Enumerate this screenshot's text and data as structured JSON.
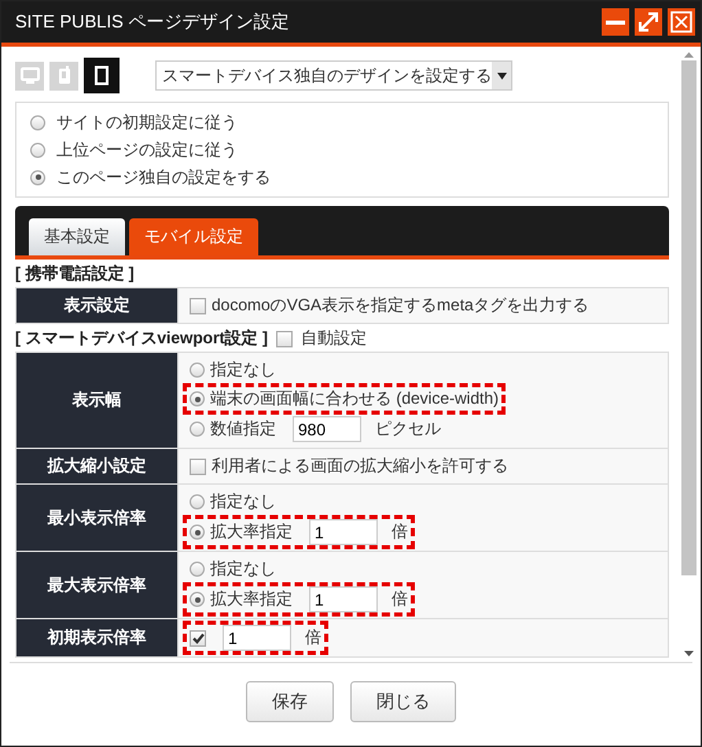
{
  "window": {
    "title": "SITE PUBLIS ページデザイン設定"
  },
  "window_controls": [
    {
      "kind": "minimize"
    },
    {
      "kind": "maximize"
    },
    {
      "kind": "close"
    }
  ],
  "devices": [
    {
      "kind": "desktop",
      "selected": false
    },
    {
      "kind": "mobile",
      "selected": false
    },
    {
      "kind": "smartphone",
      "selected": true
    }
  ],
  "design_select": {
    "value": "スマートデバイス独自のデザインを設定する"
  },
  "inherit_options": [
    {
      "label": "サイトの初期設定に従う",
      "selected": false
    },
    {
      "label": "上位ページの設定に従う",
      "selected": false
    },
    {
      "label": "このページ独自の設定をする",
      "selected": true
    }
  ],
  "tabs": [
    {
      "label": "基本設定",
      "selected": false
    },
    {
      "label": "モバイル設定",
      "selected": true
    }
  ],
  "sections": [
    {
      "title": "[ 携帯電話設定 ]",
      "rows": [
        {
          "label": "表示設定",
          "controls": [
            {
              "kind": "checkbox",
              "label": "docomoのVGA表示を指定するmetaタグを出力する",
              "checked": false,
              "highlighted": false
            }
          ]
        }
      ]
    },
    {
      "title": "[ スマートデバイスviewport設定 ]",
      "auto": {
        "label": "自動設定",
        "checked": false
      },
      "rows": [
        {
          "label": "表示幅",
          "controls": [
            {
              "kind": "radio",
              "label": "指定なし",
              "selected": false,
              "highlighted": false
            },
            {
              "kind": "radio",
              "label": "端末の画面幅に合わせる (device-width)",
              "selected": true,
              "highlighted": true
            },
            {
              "kind": "radio",
              "label": "数値指定",
              "selected": false,
              "value": "980",
              "unit": "ピクセル",
              "highlighted": false
            }
          ]
        },
        {
          "label": "拡大縮小設定",
          "controls": [
            {
              "kind": "checkbox",
              "label": "利用者による画面の拡大縮小を許可する",
              "checked": false,
              "highlighted": false
            }
          ]
        },
        {
          "label": "最小表示倍率",
          "controls": [
            {
              "kind": "radio",
              "label": "指定なし",
              "selected": false,
              "highlighted": false
            },
            {
              "kind": "radio",
              "label": "拡大率指定",
              "selected": true,
              "value": "1",
              "unit": "倍",
              "highlighted": true
            }
          ]
        },
        {
          "label": "最大表示倍率",
          "controls": [
            {
              "kind": "radio",
              "label": "指定なし",
              "selected": false,
              "highlighted": false
            },
            {
              "kind": "radio",
              "label": "拡大率指定",
              "selected": true,
              "value": "1",
              "unit": "倍",
              "highlighted": true
            }
          ]
        },
        {
          "label": "初期表示倍率",
          "controls": [
            {
              "kind": "checkbox",
              "checked": true,
              "value": "1",
              "unit": "倍",
              "highlighted": true
            }
          ]
        }
      ]
    }
  ],
  "buttons": [
    "保存",
    "閉じる"
  ]
}
